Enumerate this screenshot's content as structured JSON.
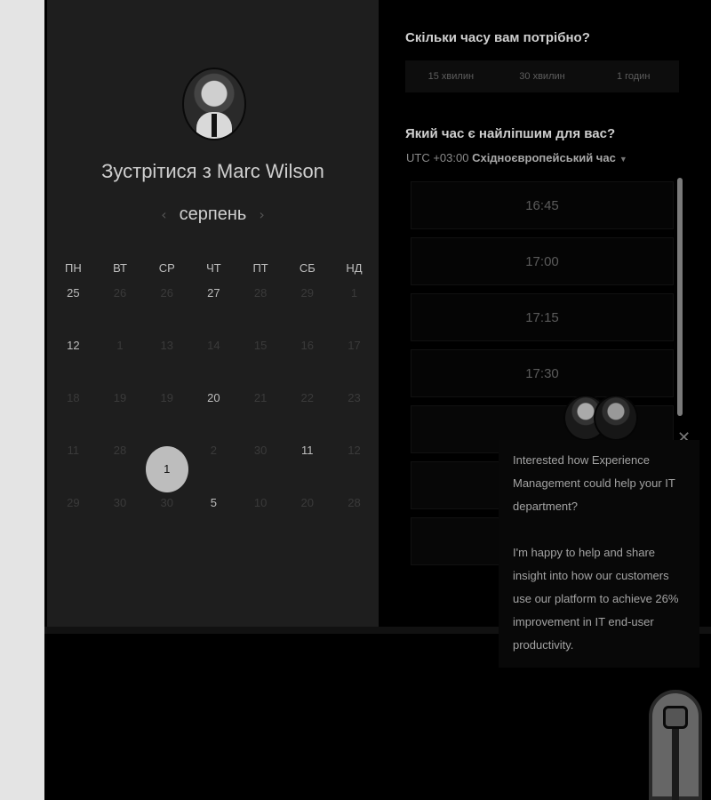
{
  "calendar": {
    "title": "Зустрітися з Marc Wilson",
    "month": "серпень",
    "weekdays": [
      "ПН",
      "ВТ",
      "СР",
      "ЧТ",
      "ПТ",
      "СБ",
      "НД"
    ],
    "weeks": [
      [
        {
          "d": "25",
          "a": true
        },
        {
          "d": "26",
          "a": false
        },
        {
          "d": "26",
          "a": false
        },
        {
          "d": "27",
          "a": true
        },
        {
          "d": "28",
          "a": false
        },
        {
          "d": "29",
          "a": false
        },
        {
          "d": "1",
          "a": false
        }
      ],
      [
        {
          "d": "12",
          "a": true
        },
        {
          "d": "1",
          "a": false
        },
        {
          "d": "13",
          "a": false
        },
        {
          "d": "14",
          "a": false
        },
        {
          "d": "15",
          "a": false
        },
        {
          "d": "16",
          "a": false
        },
        {
          "d": "17",
          "a": false
        }
      ],
      [
        {
          "d": "18",
          "a": false
        },
        {
          "d": "19",
          "a": false
        },
        {
          "d": "19",
          "a": false
        },
        {
          "d": "20",
          "a": true
        },
        {
          "d": "21",
          "a": false
        },
        {
          "d": "22",
          "a": false
        },
        {
          "d": "23",
          "a": false
        }
      ],
      [
        {
          "d": "11",
          "a": false
        },
        {
          "d": "28",
          "a": false
        },
        {
          "d": "1",
          "a": true,
          "sel": true
        },
        {
          "d": "2",
          "a": false
        },
        {
          "d": "30",
          "a": false
        },
        {
          "d": "11",
          "a": true
        },
        {
          "d": "12",
          "a": false
        }
      ],
      [
        {
          "d": "29",
          "a": false
        },
        {
          "d": "30",
          "a": false
        },
        {
          "d": "30",
          "a": false
        },
        {
          "d": "5",
          "a": true
        },
        {
          "d": "10",
          "a": false
        },
        {
          "d": "20",
          "a": false
        },
        {
          "d": "28",
          "a": false
        }
      ]
    ]
  },
  "duration": {
    "question": "Скільки часу вам потрібно?",
    "options": [
      "15 хвилин",
      "30 хвилин",
      "1 годин"
    ]
  },
  "time": {
    "question": "Який час є найліпшим для вас?",
    "timezone_prefix": "UTC +03:00",
    "timezone_name": "Східноєвропейський час",
    "slots": [
      "16:45",
      "17:00",
      "17:15",
      "17:30",
      "",
      "",
      ""
    ]
  },
  "chat": {
    "message": "Interested how Experience\nManagement could help your IT\ndepartment?\n\nI'm happy to help and share\ninsight into how our customers\nuse our platform to achieve 26%\nimprovement in IT end-user\nproductivity."
  }
}
